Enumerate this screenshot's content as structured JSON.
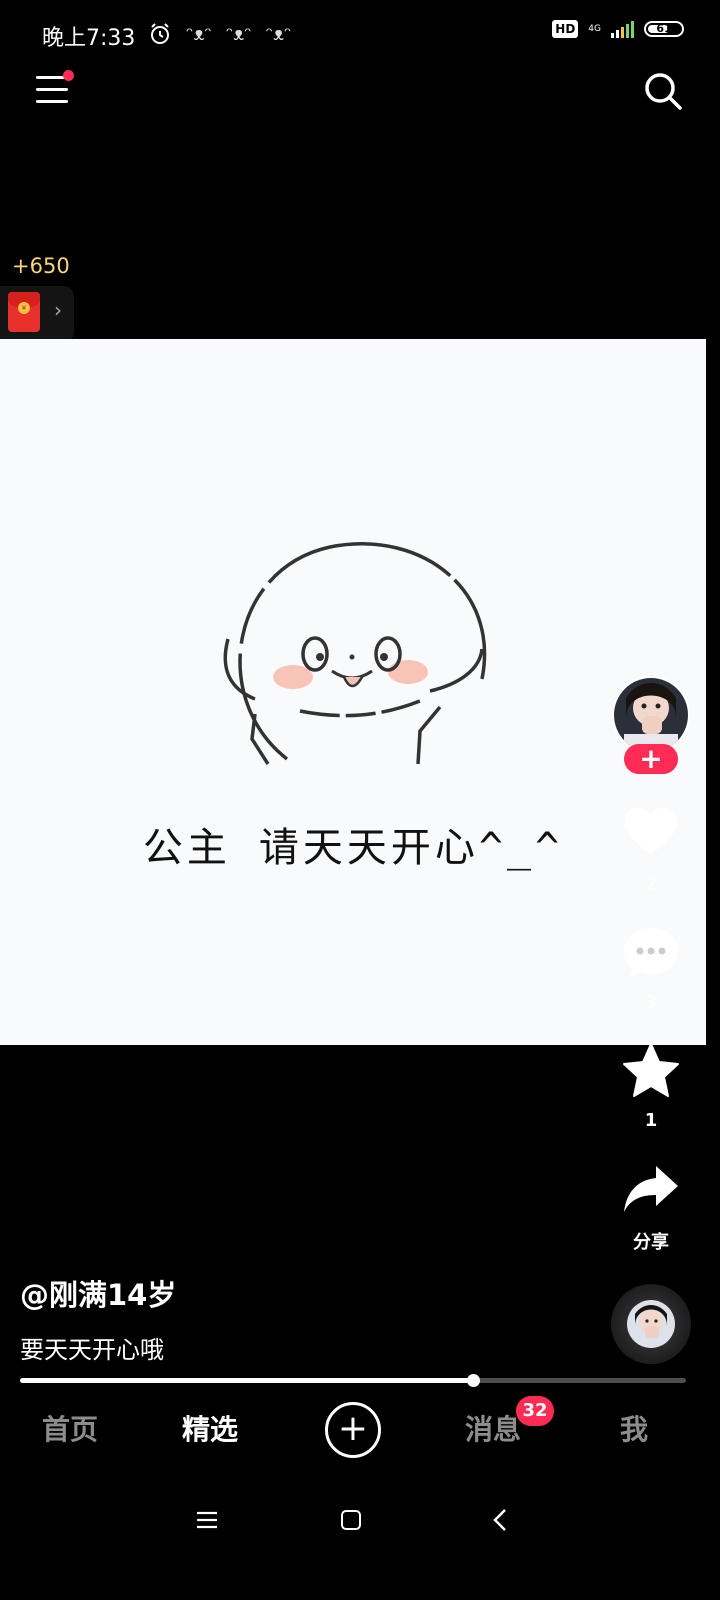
{
  "status_bar": {
    "time": "晚上7:33",
    "network": "4G",
    "hd": "HD",
    "battery": "61",
    "icons": [
      "alarm-icon",
      "notification-icon",
      "notification-icon",
      "notification-icon"
    ]
  },
  "top_bar": {
    "menu_icon": "hamburger-menu-icon",
    "search_icon": "search-icon"
  },
  "reward": {
    "amount": "+650",
    "icon": "red-envelope-icon"
  },
  "video": {
    "caption_text": "公主 请天天开心^_^"
  },
  "side_actions": {
    "like_count": "2",
    "comment_count": "3",
    "favorite_count": "1",
    "share_label": "分享",
    "follow_icon": "plus-icon"
  },
  "post": {
    "author": "@刚满14岁",
    "description": "要天天开心哦",
    "progress": 0.68
  },
  "tabs": {
    "home": "首页",
    "featured": "精选",
    "messages": "消息",
    "messages_badge": "32",
    "me": "我"
  },
  "colors": {
    "accent": "#fe2c55",
    "reward": "#f5d67a",
    "background": "#000000",
    "video_bg": "#f8fafb"
  }
}
